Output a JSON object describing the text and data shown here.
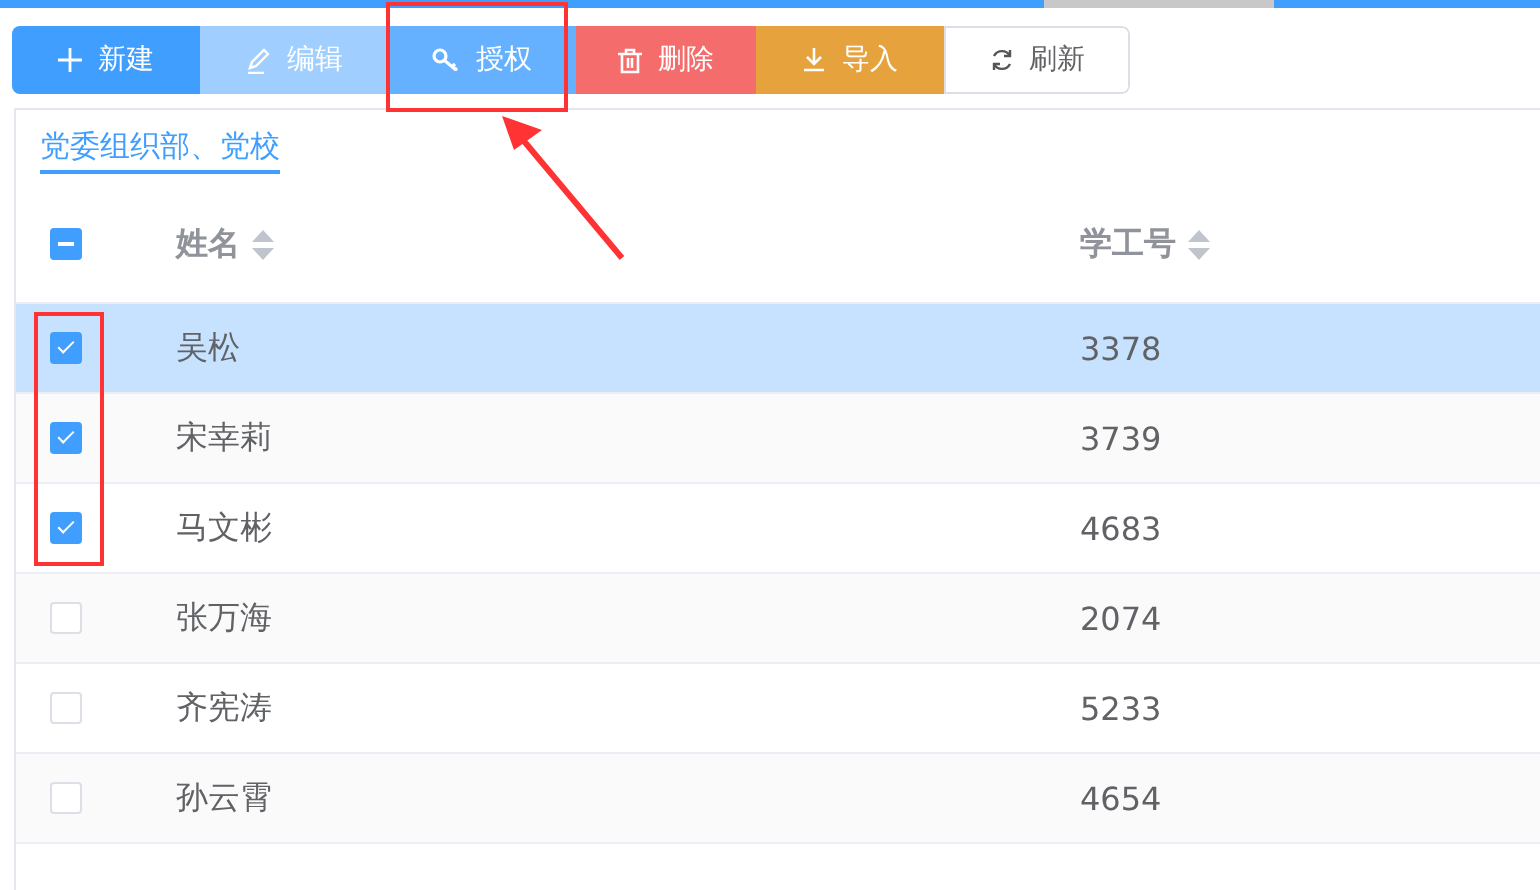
{
  "toolbar": [
    {
      "label": "新建",
      "kind": "primary"
    },
    {
      "label": "编辑",
      "kind": "edit"
    },
    {
      "label": "授权",
      "kind": "auth"
    },
    {
      "label": "删除",
      "kind": "danger"
    },
    {
      "label": "导入",
      "kind": "warning"
    },
    {
      "label": "刷新",
      "kind": "refresh"
    }
  ],
  "tabs": [
    {
      "label": "党委组织部、党校",
      "selected": true
    }
  ],
  "table": {
    "header_checkbox": {
      "indeterminate": true
    },
    "columns": [
      "姓名",
      "学工号"
    ],
    "rows": [
      {
        "checked": true,
        "selected": true,
        "cells": [
          "吴松",
          "3378"
        ]
      },
      {
        "checked": true,
        "selected": false,
        "cells": [
          "宋幸莉",
          "3739"
        ]
      },
      {
        "checked": true,
        "selected": false,
        "cells": [
          "马文彬",
          "4683"
        ]
      },
      {
        "checked": false,
        "selected": false,
        "cells": [
          "张万海",
          "2074"
        ]
      },
      {
        "checked": false,
        "selected": false,
        "cells": [
          "齐宪涛",
          "5233"
        ]
      },
      {
        "checked": false,
        "selected": false,
        "cells": [
          "孙云霄",
          "4654"
        ]
      }
    ]
  }
}
